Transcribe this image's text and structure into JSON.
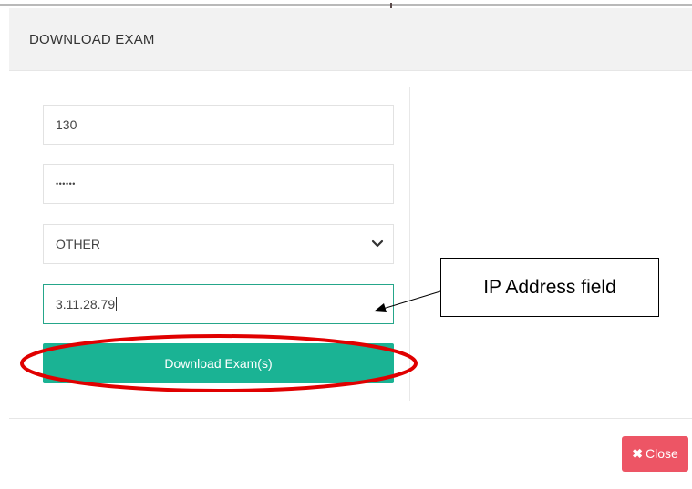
{
  "modal": {
    "title": "DOWNLOAD EXAM"
  },
  "form": {
    "user_value": "130",
    "password_value": "••••••",
    "exam_type_value": "OTHER",
    "ip_value": "3.11.28.79",
    "download_label": "Download Exam(s)"
  },
  "footer": {
    "close_label": "Close",
    "close_icon": "✖"
  },
  "annotation": {
    "label": "IP Address field"
  },
  "colors": {
    "primary": "#1ab394",
    "danger": "#ed5565",
    "highlight_ellipse": "#e00000"
  }
}
